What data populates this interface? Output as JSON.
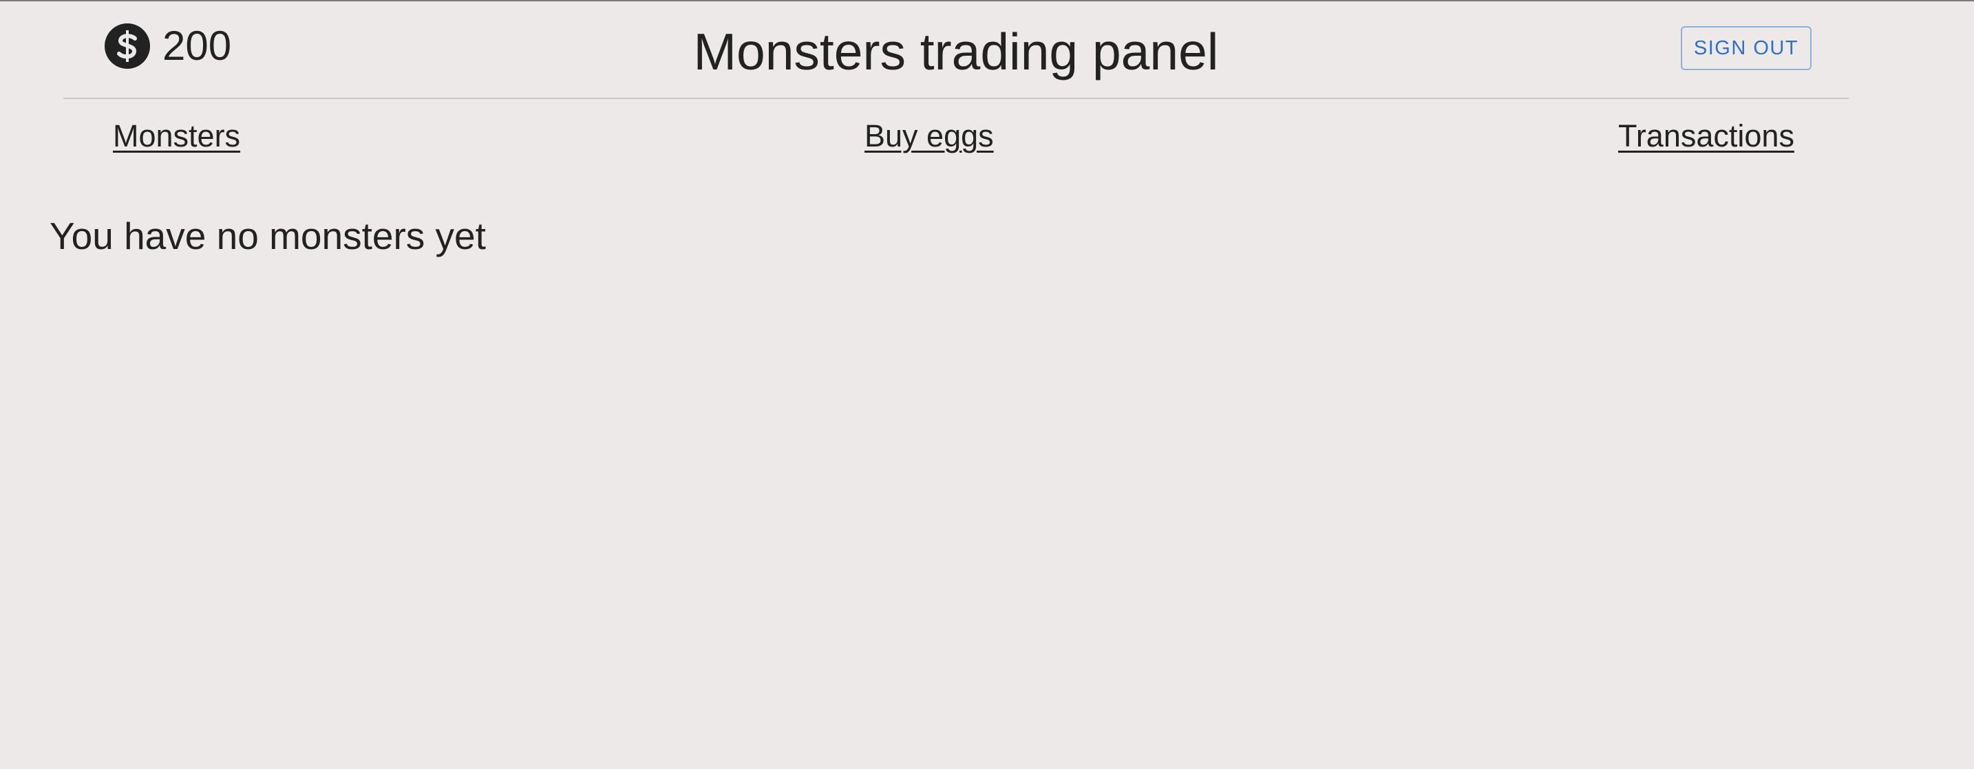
{
  "header": {
    "balance": "200",
    "balance_icon": "dollar-coin-icon",
    "title": "Monsters trading panel",
    "signout_label": "SIGN OUT"
  },
  "nav": {
    "items": [
      {
        "label": "Monsters"
      },
      {
        "label": "Buy eggs"
      },
      {
        "label": "Transactions"
      }
    ]
  },
  "main": {
    "empty_message": "You have no monsters yet"
  },
  "colors": {
    "background": "#ede9e8",
    "text": "#222222",
    "accent": "#2f6fc8",
    "accent_border": "#8fb0dc"
  }
}
